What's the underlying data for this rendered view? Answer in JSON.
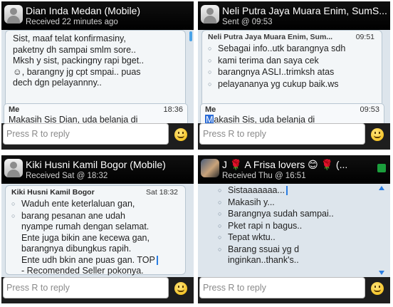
{
  "placeholder": "Press R to reply",
  "panels": [
    {
      "name": "Dian Inda Medan (Mobile)",
      "sub": "Received 22 minutes ago",
      "lines": [
        "Sist, maaf telat konfirmasiny,",
        "paketny dh sampai smlm sore..",
        "Mksh y sist, packingny rapi bget..",
        "☺, barangny jg cpt smpai.. puas",
        "dech dgn pelayannny.."
      ],
      "me_label": "Me",
      "me_time": "18:36",
      "me_text": "Makasih Sis Dian, uda belanja di"
    },
    {
      "name": "Neli Putra Jaya Muara Enim, SumS...",
      "sub": "Sent @ 09:53",
      "header_name": "Neli Putra Jaya Muara Enim, Sum...",
      "header_time": "09:51",
      "lines": [
        "Sebagai info..utk barangnya sdh",
        "kami terima dan saya cek",
        "barangnya ASLI..trimksh atas",
        "pelayananya yg cukup baik.ws"
      ],
      "me_label": "Me",
      "me_time": "09:53",
      "me_first": "M",
      "me_text": "akasih Sis, uda belanja di"
    },
    {
      "name": "Kiki Husni Kamil Bogor (Mobile)",
      "sub": "Received Sat @ 18:32",
      "header_name": "Kiki Husni Kamil Bogor",
      "header_time": "Sat 18:32",
      "lines": [
        "Waduh ente keterlaluan gan,",
        "barang pesanan ane udah",
        "nyampe rumah dengan selamat.",
        "Ente juga bikin ane kecewa gan,",
        "barangnya dibungkus rapih.",
        "Ente udh bkin ane puas gan. TOP",
        "- Recomended Seller pokonya."
      ]
    },
    {
      "name": "J 🌹 A Frisa lovers 😊 🌹 (...",
      "sub": "Received Thu @ 16:51",
      "items": [
        "Sistaaaaaaa...",
        "Makasih y...",
        "Barangnya sudah sampai..",
        "Pket rapi n bagus..",
        "Tepat wktu..",
        "Barang ssuai yg d",
        "inginkan..thank's.."
      ]
    }
  ]
}
